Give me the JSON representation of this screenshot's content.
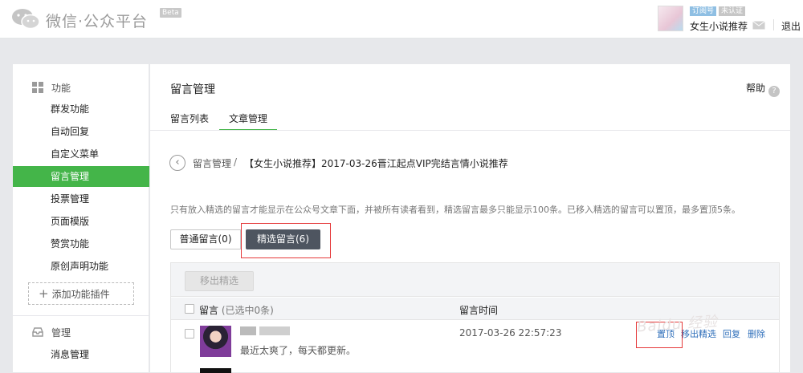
{
  "header": {
    "logo_text": "微信·公众平台",
    "beta": "Beta",
    "account_type": "订阅号",
    "verify_status": "未认证",
    "account_name": "女生小说推荐",
    "logout": "退出"
  },
  "sidebar": {
    "section_function": "功能",
    "items": [
      {
        "label": "群发功能"
      },
      {
        "label": "自动回复"
      },
      {
        "label": "自定义菜单"
      },
      {
        "label": "留言管理"
      },
      {
        "label": "投票管理"
      },
      {
        "label": "页面模版"
      },
      {
        "label": "赞赏功能"
      },
      {
        "label": "原创声明功能"
      }
    ],
    "add_plugin": "添加功能插件",
    "section_manage": "管理",
    "manage_items": [
      {
        "label": "消息管理"
      }
    ]
  },
  "main": {
    "title": "留言管理",
    "help": "帮助",
    "tabs": [
      {
        "label": "留言列表"
      },
      {
        "label": "文章管理"
      }
    ],
    "breadcrumb": {
      "root": "留言管理",
      "sep": "/",
      "current": "【女生小说推荐】2017-03-26晋江起点VIP完结言情小说推荐"
    },
    "notice": "只有放入精选的留言才能显示在公众号文章下面，并被所有读者看到，精选留言最多只能显示100条。已移入精选的留言可以置顶，最多置顶5条。",
    "filters": {
      "normal": "普通留言(0)",
      "selected": "精选留言(6)"
    },
    "grid": {
      "remove_button": "移出精选",
      "col_message": "留言",
      "col_message_sub": "(已选中0条)",
      "col_time": "留言时间",
      "rows": [
        {
          "text": "最近太爽了，每天都更新。",
          "time": "2017-03-26 22:57:23",
          "ops": {
            "pin": "置顶",
            "remove": "移出精选",
            "reply": "回复",
            "delete": "删除"
          }
        }
      ]
    }
  },
  "watermark": "Baidu 经验",
  "colors": {
    "accent": "#44b549",
    "highlight": "#e5393a",
    "link": "#2f6fba"
  }
}
